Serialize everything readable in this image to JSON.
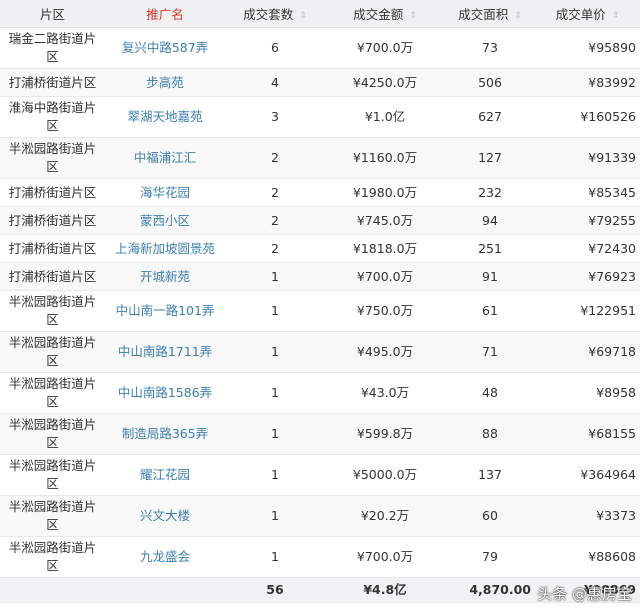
{
  "headers": [
    "片区",
    "推广名",
    "成交套数",
    "成交金额",
    "成交面积",
    "成交单价"
  ],
  "rows": [
    [
      "瑞金二路街道片区",
      "复兴中路587弄",
      "6",
      "¥700.0万",
      "73",
      "¥95890"
    ],
    [
      "打浦桥街道片区",
      "步高苑",
      "4",
      "¥4250.0万",
      "506",
      "¥83992"
    ],
    [
      "淮海中路街道片区",
      "翠湖天地嘉苑",
      "3",
      "¥1.0亿",
      "627",
      "¥160526"
    ],
    [
      "半淞园路街道片区",
      "中福浦江汇",
      "2",
      "¥1160.0万",
      "127",
      "¥91339"
    ],
    [
      "打浦桥街道片区",
      "海华花园",
      "2",
      "¥1980.0万",
      "232",
      "¥85345"
    ],
    [
      "打浦桥街道片区",
      "蒙西小区",
      "2",
      "¥745.0万",
      "94",
      "¥79255"
    ],
    [
      "打浦桥街道片区",
      "上海新加坡圆景苑",
      "2",
      "¥1818.0万",
      "251",
      "¥72430"
    ],
    [
      "打浦桥街道片区",
      "开城新苑",
      "1",
      "¥700.0万",
      "91",
      "¥76923"
    ],
    [
      "半淞园路街道片区",
      "中山南一路101弄",
      "1",
      "¥750.0万",
      "61",
      "¥122951"
    ],
    [
      "半淞园路街道片区",
      "中山南路1711弄",
      "1",
      "¥495.0万",
      "71",
      "¥69718"
    ],
    [
      "半淞园路街道片区",
      "中山南路1586弄",
      "1",
      "¥43.0万",
      "48",
      "¥8958"
    ],
    [
      "半淞园路街道片区",
      "制造局路365弄",
      "1",
      "¥599.8万",
      "88",
      "¥68155"
    ],
    [
      "半淞园路街道片区",
      "耀江花园",
      "1",
      "¥5000.0万",
      "137",
      "¥364964"
    ],
    [
      "半淞园路街道片区",
      "兴文大楼",
      "1",
      "¥20.2万",
      "60",
      "¥3373"
    ],
    [
      "半淞园路街道片区",
      "九龙盛会",
      "1",
      "¥700.0万",
      "79",
      "¥88608"
    ]
  ],
  "totals": [
    "",
    "",
    "56",
    "¥4.8亿",
    "4,870.00",
    "¥98869"
  ],
  "watermark": "头条 @惠房宝"
}
